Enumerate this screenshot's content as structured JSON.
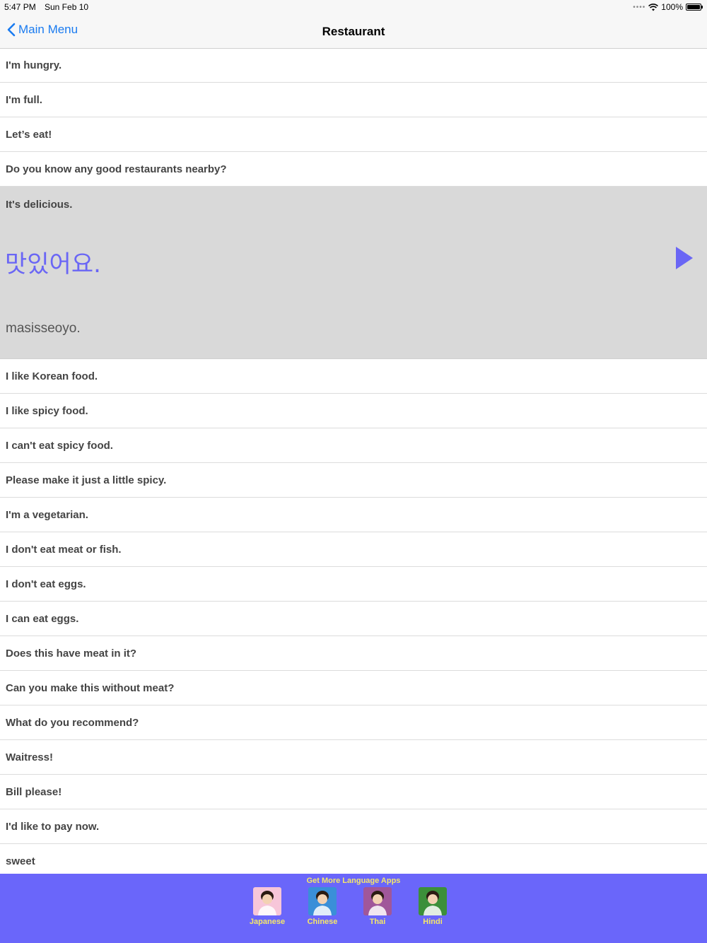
{
  "status_bar": {
    "time": "5:47 PM",
    "date": "Sun Feb 10",
    "battery": "100%"
  },
  "nav": {
    "back_label": "Main Menu",
    "title": "Restaurant"
  },
  "phrases_before": [
    "I'm hungry.",
    "I'm full.",
    "Let’s eat!",
    "Do you know any good restaurants nearby?"
  ],
  "selected": {
    "english": "It's delicious.",
    "korean": "맛있어요.",
    "romanization": "masisseoyo."
  },
  "phrases_after": [
    "I like Korean food.",
    "I like spicy food.",
    "I can't eat spicy food.",
    "Please make it just a little spicy.",
    "I'm a vegetarian.",
    "I don't eat meat or fish.",
    "I don't eat eggs.",
    "I can eat eggs.",
    "Does this have meat in it?",
    "Can you make this without meat?",
    "What do you recommend?",
    "Waitress!",
    "Bill please!",
    "I'd like to pay now.",
    "sweet"
  ],
  "footer": {
    "title": "Get More Language Apps",
    "apps": [
      {
        "label": "Japanese",
        "icon": "japanese-app-icon",
        "bg": "#f7c6d9"
      },
      {
        "label": "Chinese",
        "icon": "chinese-app-icon",
        "bg": "#3a8fd8"
      },
      {
        "label": "Thai",
        "icon": "thai-app-icon",
        "bg": "#a0579a"
      },
      {
        "label": "Hindi",
        "icon": "hindi-app-icon",
        "bg": "#3c8f3a"
      }
    ]
  },
  "colors": {
    "accent": "#1a7bf0",
    "korean_text": "#6a66f5",
    "footer_bg": "#6a66fa",
    "footer_text": "#f5e76a",
    "selected_bg": "#d9d9d9"
  }
}
